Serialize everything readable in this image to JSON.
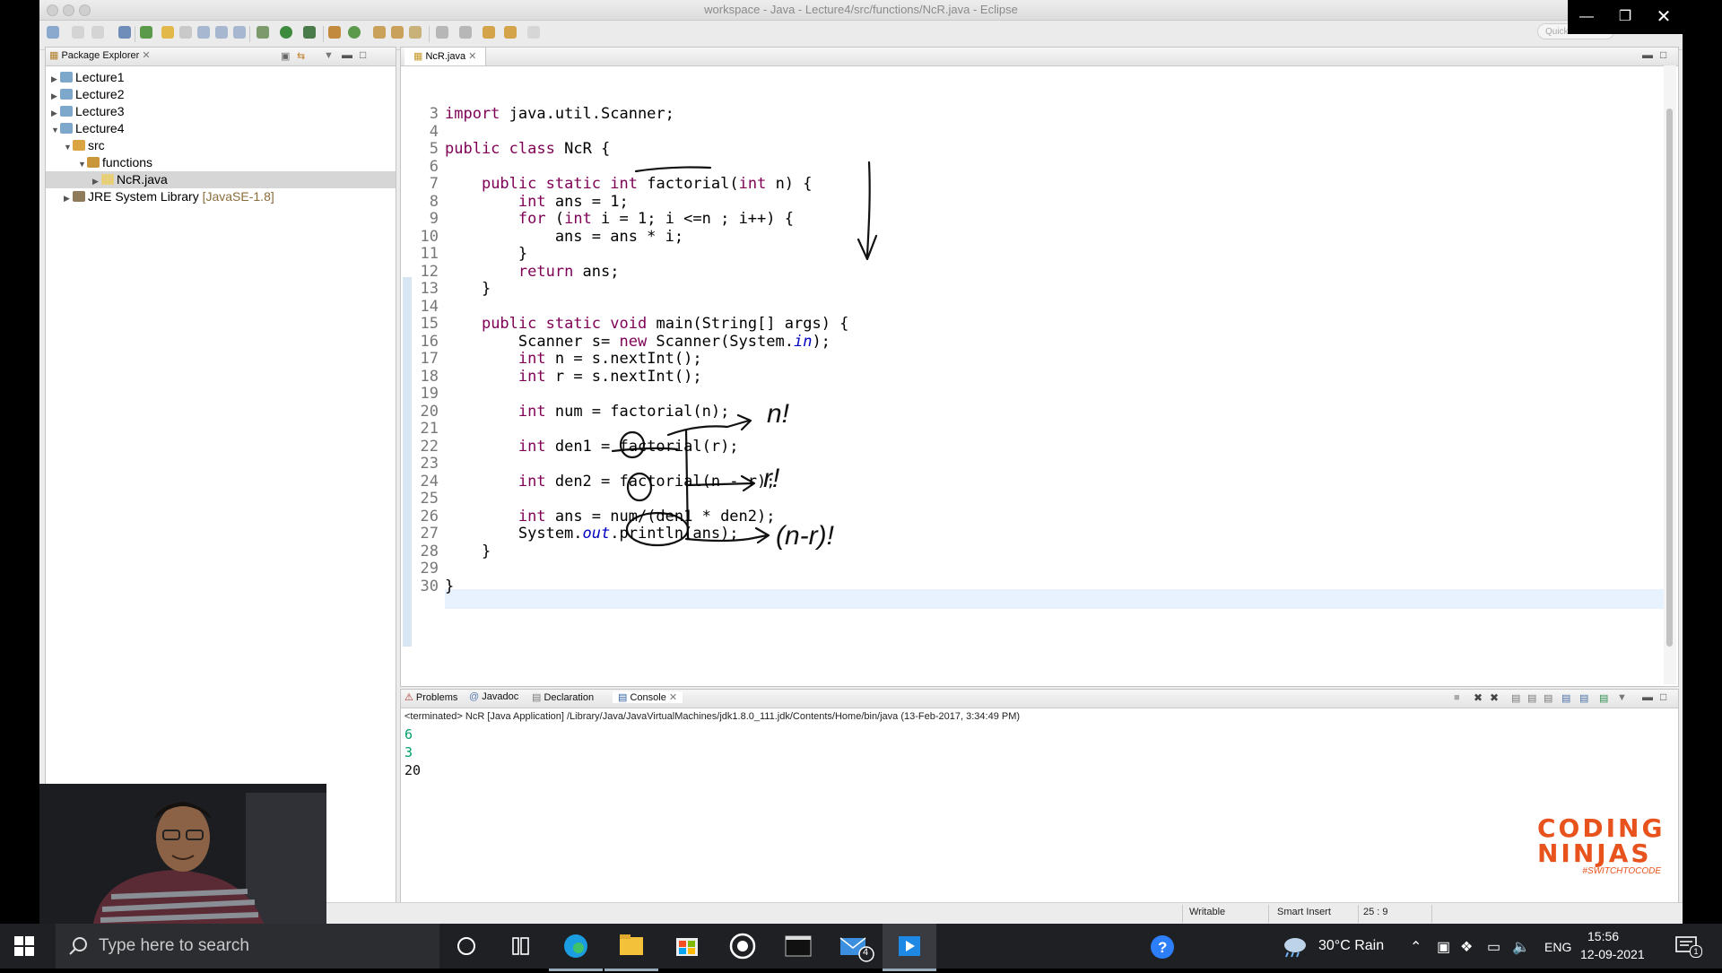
{
  "window": {
    "title": "workspace - Java - Lecture4/src/functions/NcR.java - Eclipse",
    "quick_access": "Quick Access"
  },
  "package_explorer": {
    "tab_label": "Package Explorer",
    "items": [
      {
        "label": "Lecture1",
        "depth": 0
      },
      {
        "label": "Lecture2",
        "depth": 0
      },
      {
        "label": "Lecture3",
        "depth": 0
      },
      {
        "label": "Lecture4",
        "depth": 0
      },
      {
        "label": "src",
        "depth": 1
      },
      {
        "label": "functions",
        "depth": 2
      },
      {
        "label": "NcR.java",
        "depth": 3
      },
      {
        "label": "JRE System Library",
        "suffix": "[JavaSE-1.8]",
        "depth": 1
      }
    ]
  },
  "editor": {
    "tab_label": "NcR.java",
    "lines": [
      {
        "n": "3",
        "code": "import java.util.Scanner;"
      },
      {
        "n": "4",
        "code": ""
      },
      {
        "n": "5",
        "code": "public class NcR {"
      },
      {
        "n": "6",
        "code": ""
      },
      {
        "n": "7",
        "code": "    public static int factorial(int n) {"
      },
      {
        "n": "8",
        "code": "        int ans = 1;"
      },
      {
        "n": "9",
        "code": "        for (int i = 1; i <=n ; i++) {"
      },
      {
        "n": "10",
        "code": "            ans = ans * i;"
      },
      {
        "n": "11",
        "code": "        }"
      },
      {
        "n": "12",
        "code": "        return ans;"
      },
      {
        "n": "13",
        "code": "    }"
      },
      {
        "n": "14",
        "code": ""
      },
      {
        "n": "15",
        "code": "    public static void main(String[] args) {"
      },
      {
        "n": "16",
        "code": "        Scanner s= new Scanner(System.in);"
      },
      {
        "n": "17",
        "code": "        int n = s.nextInt();"
      },
      {
        "n": "18",
        "code": "        int r = s.nextInt();"
      },
      {
        "n": "19",
        "code": ""
      },
      {
        "n": "20",
        "code": "        int num = factorial(n);"
      },
      {
        "n": "21",
        "code": ""
      },
      {
        "n": "22",
        "code": "        int den1 = factorial(r);"
      },
      {
        "n": "23",
        "code": ""
      },
      {
        "n": "24",
        "code": "        int den2 = factorial(n - r);"
      },
      {
        "n": "25",
        "code": ""
      },
      {
        "n": "26",
        "code": "        int ans = num/(den1 * den2);"
      },
      {
        "n": "27",
        "code": "        System.out.println(ans);"
      },
      {
        "n": "28",
        "code": "    }"
      },
      {
        "n": "29",
        "code": ""
      },
      {
        "n": "30",
        "code": "}"
      }
    ],
    "annotations": {
      "num": "n!",
      "den1": "r!",
      "den2": "(n-r)!"
    }
  },
  "bottom_tabs": {
    "problems": "Problems",
    "javadoc": "Javadoc",
    "declaration": "Declaration",
    "console": "Console"
  },
  "console": {
    "header": "<terminated> NcR [Java Application] /Library/Java/JavaVirtualMachines/jdk1.8.0_111.jdk/Contents/Home/bin/java (13-Feb-2017, 3:34:49 PM)",
    "input_lines": [
      "6",
      "3"
    ],
    "output_lines": [
      "20"
    ],
    "input_color": "#00a06a"
  },
  "status_bar": {
    "writable": "Writable",
    "insert_mode": "Smart Insert",
    "position": "25 : 9"
  },
  "logo": {
    "line1": "CODING",
    "line2": "NINJAS",
    "tagline": "#SWITCHTOCODE",
    "color": "#e8531d"
  },
  "taskbar": {
    "search_placeholder": "Type here to search",
    "mail_badge": "4",
    "weather": "30°C  Rain",
    "language": "ENG",
    "time": "15:56",
    "date": "12-09-2021",
    "notification_count": "1"
  }
}
